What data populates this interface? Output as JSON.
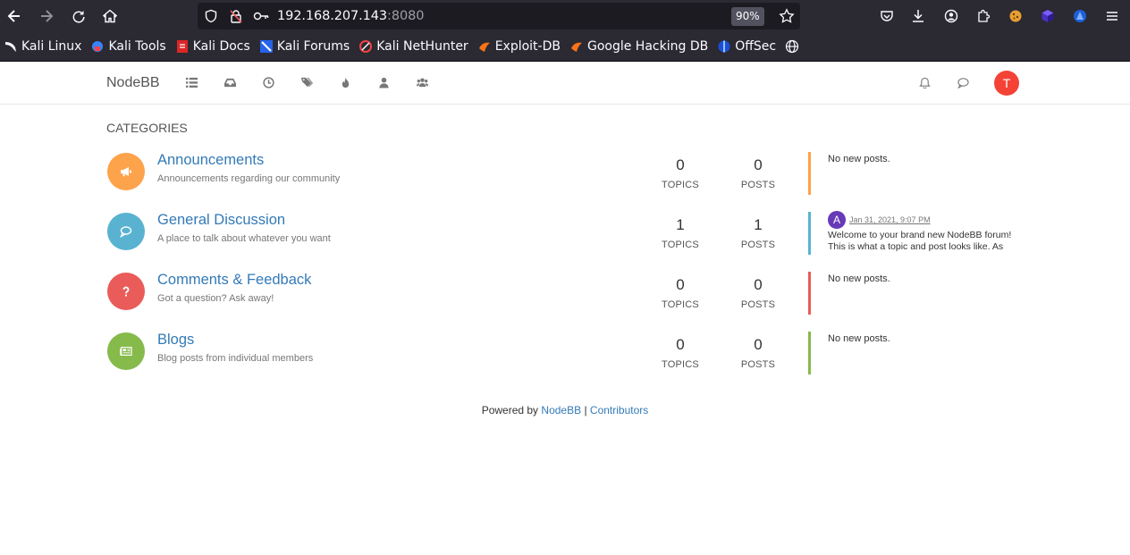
{
  "browser": {
    "url_host": "192.168.207.143",
    "url_port": ":8080",
    "zoom": "90%",
    "bookmarks": [
      "Kali Linux",
      "Kali Tools",
      "Kali Docs",
      "Kali Forums",
      "Kali NetHunter",
      "Exploit-DB",
      "Google Hacking DB",
      "OffSec"
    ]
  },
  "header": {
    "brand": "NodeBB",
    "user_initial": "T",
    "nav_icons": [
      "categories-icon",
      "unread-icon",
      "recent-icon",
      "tags-icon",
      "popular-icon",
      "users-icon",
      "groups-icon"
    ]
  },
  "section_title": "CATEGORIES",
  "stat_labels": {
    "topics": "TOPICS",
    "posts": "POSTS"
  },
  "categories": [
    {
      "name": "Announcements",
      "description": "Announcements regarding our community",
      "topics": "0",
      "posts": "0",
      "teaser": "No new posts.",
      "color": "#fda34b",
      "icon": "bullhorn-icon"
    },
    {
      "name": "General Discussion",
      "description": "A place to talk about whatever you want",
      "topics": "1",
      "posts": "1",
      "teaser_user": "A",
      "teaser_time": "Jan 31, 2021, 9:07 PM",
      "teaser_text": "Welcome to your brand new NodeBB forum! This is what a topic and post looks like. As",
      "color": "#59b3d0",
      "icon": "comments-icon"
    },
    {
      "name": "Comments & Feedback",
      "description": "Got a question? Ask away!",
      "topics": "0",
      "posts": "0",
      "teaser": "No new posts.",
      "color": "#e95c5a",
      "icon": "question-icon"
    },
    {
      "name": "Blogs",
      "description": "Blog posts from individual members",
      "topics": "0",
      "posts": "0",
      "teaser": "No new posts.",
      "color": "#86ba4b",
      "icon": "newspaper-icon"
    }
  ],
  "footer": {
    "prefix": "Powered by",
    "nodebb": "NodeBB",
    "separator": "|",
    "contributors": "Contributors"
  }
}
